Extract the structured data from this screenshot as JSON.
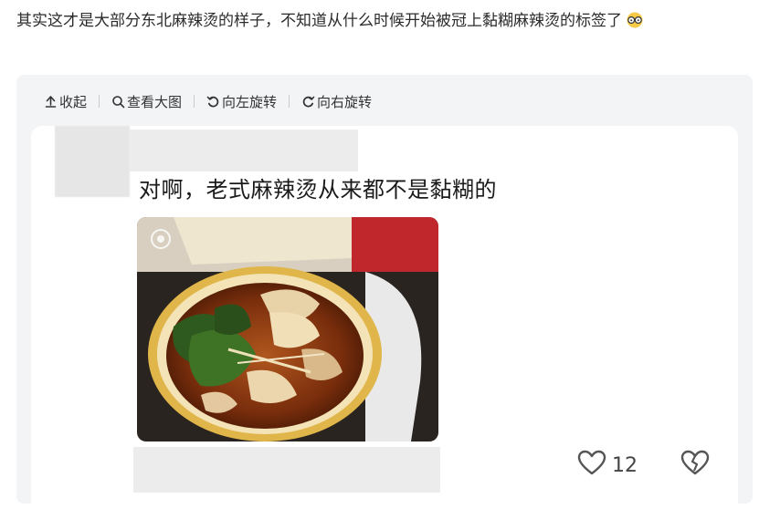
{
  "post": {
    "text": "其实这才是大部分东北麻辣烫的样子，不知道从什么时候开始被冠上黏糊麻辣烫的标签了"
  },
  "toolbar": {
    "collapse_label": "收起",
    "view_large_label": "查看大图",
    "rotate_left_label": "向左旋转",
    "rotate_right_label": "向右旋转"
  },
  "image": {
    "caption": "对啊，老式麻辣烫从来都不是黏糊的"
  },
  "actions": {
    "like_count": "12"
  },
  "colors": {
    "card_bg": "#f3f4f6",
    "text": "#2b2b2b"
  }
}
